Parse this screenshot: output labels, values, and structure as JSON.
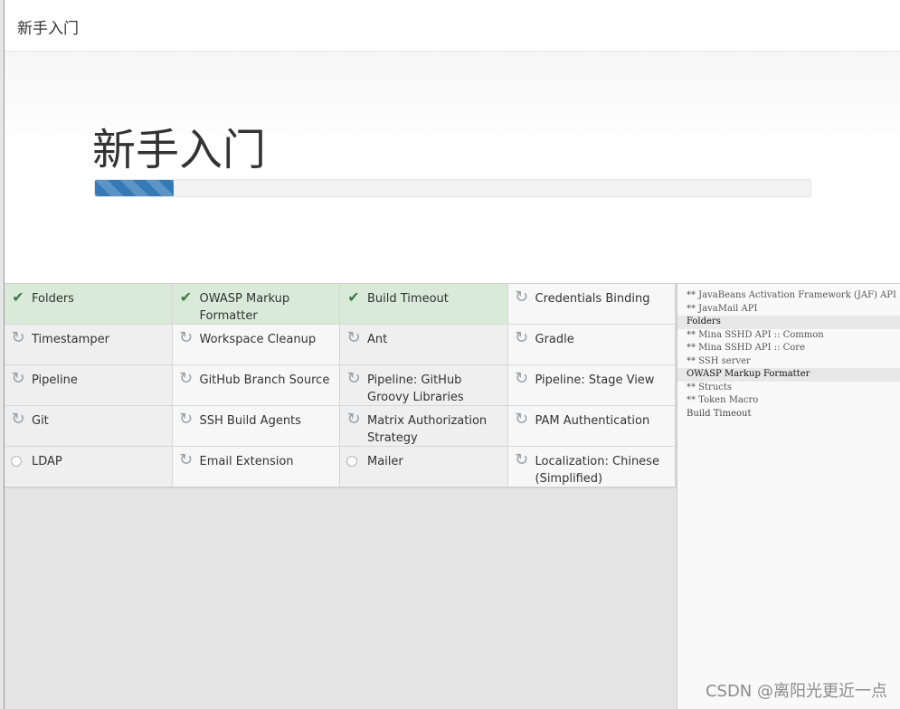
{
  "window": {
    "title": "新手入门"
  },
  "hero": {
    "heading": "新手入门",
    "progress_percent": 11
  },
  "plugins": [
    {
      "name": "Folders",
      "status": "installed",
      "icon": "check-icon"
    },
    {
      "name": "OWASP Markup Formatter",
      "status": "installed",
      "icon": "check-icon"
    },
    {
      "name": "Build Timeout",
      "status": "installed",
      "icon": "check-icon"
    },
    {
      "name": "Credentials Binding",
      "status": "installing",
      "icon": "refresh-icon"
    },
    {
      "name": "Timestamper",
      "status": "installing",
      "icon": "refresh-icon"
    },
    {
      "name": "Workspace Cleanup",
      "status": "installing",
      "icon": "refresh-icon"
    },
    {
      "name": "Ant",
      "status": "installing",
      "icon": "refresh-icon"
    },
    {
      "name": "Gradle",
      "status": "installing",
      "icon": "refresh-icon"
    },
    {
      "name": "Pipeline",
      "status": "installing",
      "icon": "refresh-icon"
    },
    {
      "name": "GitHub Branch Source",
      "status": "installing",
      "icon": "refresh-icon"
    },
    {
      "name": "Pipeline: GitHub Groovy Libraries",
      "status": "installing",
      "icon": "refresh-icon"
    },
    {
      "name": "Pipeline: Stage View",
      "status": "installing",
      "icon": "refresh-icon"
    },
    {
      "name": "Git",
      "status": "installing",
      "icon": "refresh-icon"
    },
    {
      "name": "SSH Build Agents",
      "status": "installing",
      "icon": "refresh-icon"
    },
    {
      "name": "Matrix Authorization Strategy",
      "status": "installing",
      "icon": "refresh-icon"
    },
    {
      "name": "PAM Authentication",
      "status": "installing",
      "icon": "refresh-icon"
    },
    {
      "name": "LDAP",
      "status": "pending",
      "icon": "pending-circle-icon"
    },
    {
      "name": "Email Extension",
      "status": "installing",
      "icon": "refresh-icon"
    },
    {
      "name": "Mailer",
      "status": "pending",
      "icon": "pending-circle-icon"
    },
    {
      "name": "Localization: Chinese (Simplified)",
      "status": "installing",
      "icon": "refresh-icon"
    }
  ],
  "log": [
    {
      "text": "** JavaBeans Activation Framework (JAF) API",
      "kind": "dep"
    },
    {
      "text": "** JavaMail API",
      "kind": "dep"
    },
    {
      "text": "Folders",
      "kind": "header"
    },
    {
      "text": "** Mina SSHD API :: Common",
      "kind": "dep"
    },
    {
      "text": "** Mina SSHD API :: Core",
      "kind": "dep"
    },
    {
      "text": "** SSH server",
      "kind": "dep"
    },
    {
      "text": "OWASP Markup Formatter",
      "kind": "header"
    },
    {
      "text": "** Structs",
      "kind": "dep"
    },
    {
      "text": "** Token Macro",
      "kind": "dep"
    },
    {
      "text": "Build Timeout",
      "kind": "plain"
    }
  ],
  "watermark": "CSDN @离阳光更近一点",
  "colors": {
    "progress": "#337ab7",
    "success_bg": "#d9ebd8",
    "check": "#3d7a44"
  }
}
